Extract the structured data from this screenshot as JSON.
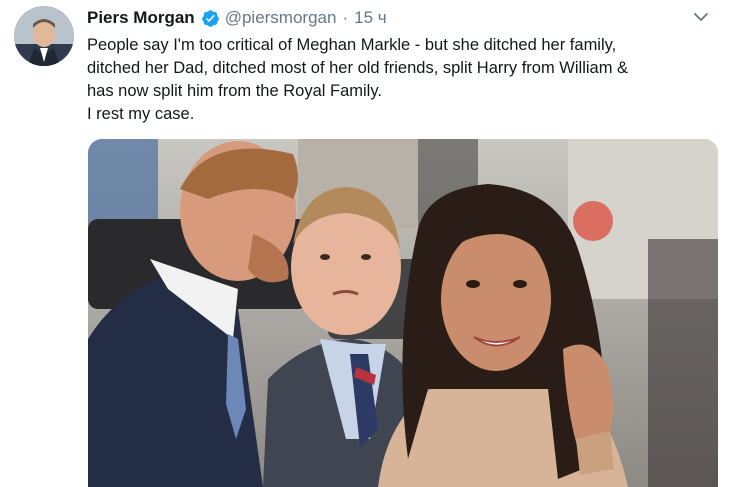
{
  "tweet": {
    "author_name": "Piers Morgan",
    "handle": "@piersmorgan",
    "separator": "·",
    "time": "15 ч",
    "verified": true,
    "text_lines": [
      "People say I'm too critical of Meghan Markle - but she ditched her family,",
      "ditched her Dad, ditched most of her old friends, split Harry from William &",
      "has now split him from the Royal Family.",
      "I rest my case."
    ]
  },
  "icons": {
    "verified": "verified-badge-icon",
    "menu": "chevron-down-icon"
  },
  "colors": {
    "accent": "#1da1f2",
    "secondary_text": "#657786",
    "primary_text": "#14171a"
  }
}
